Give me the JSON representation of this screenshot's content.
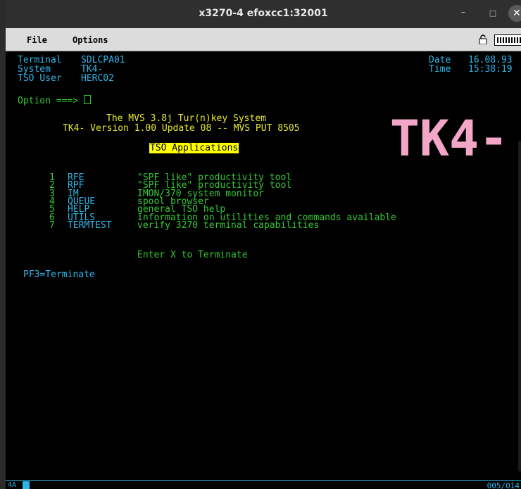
{
  "window": {
    "title": "x3270-4 efoxcc1:32001",
    "minimize_glyph": "–",
    "maximize_glyph": "□",
    "close_glyph": "✕"
  },
  "menubar": {
    "file": "File",
    "options": "Options"
  },
  "header": {
    "terminal_label": "Terminal",
    "terminal_value": "SDLCPA01",
    "system_label": "System",
    "system_value": "TK4-",
    "tso_label": "TSO User",
    "tso_value": "HERC02",
    "date_label": "Date",
    "date_value": "16.08.93",
    "time_label": "Time",
    "time_value": "15:38:19"
  },
  "option_prompt": "Option ===>",
  "banner": {
    "line1": "The MVS 3.8j Tur(n)key System",
    "line2": "TK4- Version 1.00 Update 08 -- MVS PUT 8505",
    "heading": "TSO Applications",
    "logo_text": "TK4-"
  },
  "menu_items": [
    {
      "num": "1",
      "name": "RFE",
      "desc": "\"SPF like\" productivity tool"
    },
    {
      "num": "2",
      "name": "RPF",
      "desc": "\"SPF like\" productivity tool"
    },
    {
      "num": "3",
      "name": "IM",
      "desc": "IMON/370 system monitor"
    },
    {
      "num": "4",
      "name": "QUEUE",
      "desc": "spool browser"
    },
    {
      "num": "5",
      "name": "HELP",
      "desc": "general TSO help"
    },
    {
      "num": "6",
      "name": "UTILS",
      "desc": "information on utilities and commands available"
    },
    {
      "num": "7",
      "name": "TERMTEST",
      "desc": "verify 3270 terminal capabilities"
    }
  ],
  "terminate_hint": "Enter X to Terminate",
  "pf3": "PF3=Terminate",
  "status": {
    "left": "4A",
    "cursor_pos": "005/014"
  },
  "colors": {
    "cyan": "#2fb5e8",
    "green": "#34c934",
    "yellow": "#e8e82e",
    "logo_pink": "#f4a6c8"
  }
}
